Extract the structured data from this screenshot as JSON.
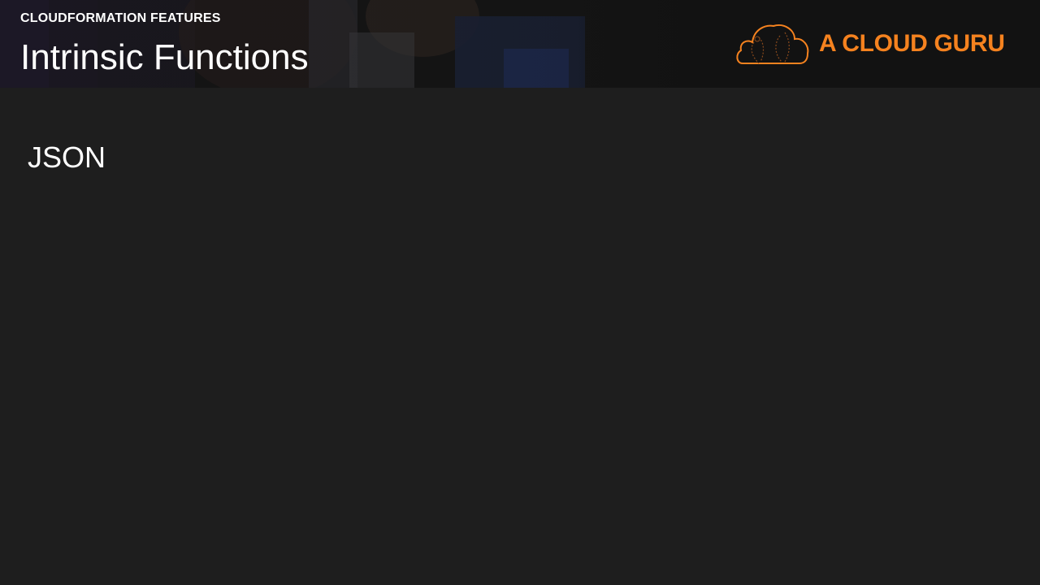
{
  "header": {
    "kicker": "CLOUDFORMATION FEATURES",
    "title": "Intrinsic Functions"
  },
  "brand": {
    "name": "A CLOUD GURU",
    "icon": "cloud-logo-icon",
    "color": "#f5821f"
  },
  "content": {
    "section_label": "JSON"
  },
  "colors": {
    "background": "#1e1e1e",
    "header_background": "#121212",
    "text": "#ffffff"
  }
}
